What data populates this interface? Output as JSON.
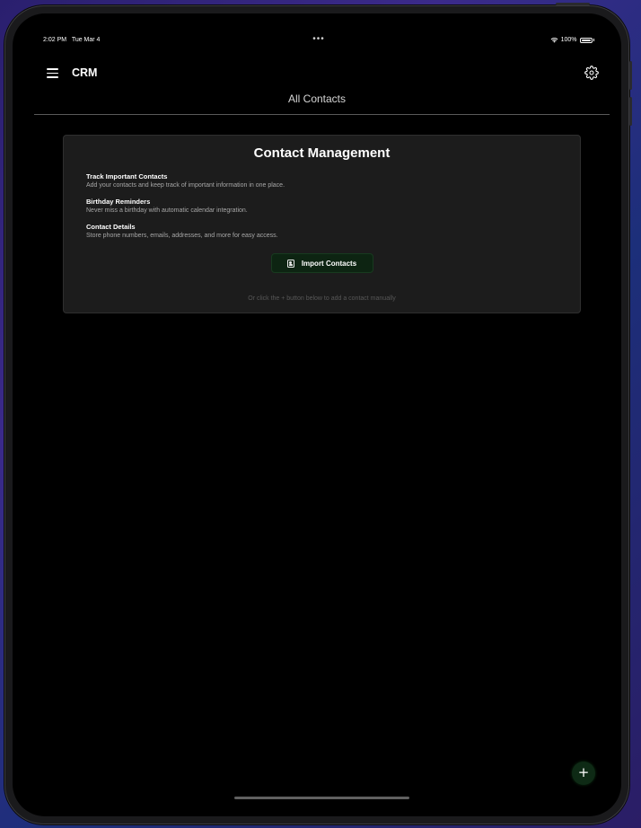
{
  "status_bar": {
    "time": "2:02 PM",
    "date": "Tue Mar 4",
    "multitask_indicator": "•••",
    "battery": "100%"
  },
  "nav": {
    "app_title": "CRM",
    "menu_icon": "hamburger-menu-icon",
    "settings_icon": "gear-icon"
  },
  "page": {
    "heading": "All Contacts"
  },
  "card": {
    "title": "Contact Management",
    "features": [
      {
        "title": "Track Important Contacts",
        "description": "Add your contacts and keep track of important information in one place."
      },
      {
        "title": "Birthday Reminders",
        "description": "Never miss a birthday with automatic calendar integration."
      },
      {
        "title": "Contact Details",
        "description": "Store phone numbers, emails, addresses, and more for easy access."
      }
    ],
    "import_button": {
      "label": "Import Contacts",
      "icon": "contact-card-icon"
    },
    "hint": "Or click the + button below to add a contact manually"
  },
  "fab": {
    "label": "+",
    "icon": "plus-icon"
  },
  "colors": {
    "background": "#000000",
    "card_background": "#1c1c1c",
    "accent_green": "#0d2412"
  }
}
